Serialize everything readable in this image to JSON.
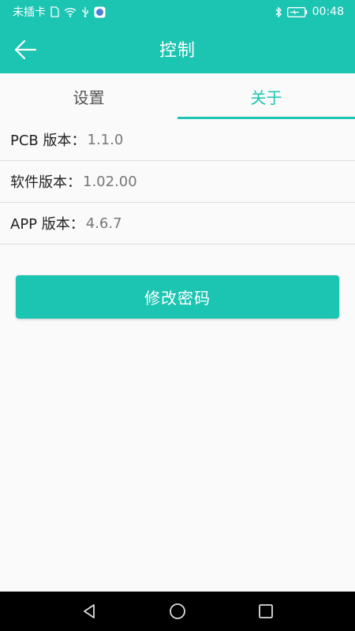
{
  "status_bar": {
    "carrier": "未插卡",
    "time": "00:48",
    "icons": [
      "sim-icon",
      "wifi-icon",
      "usb-icon",
      "app-notification-icon",
      "bluetooth-icon",
      "battery-charging-icon"
    ]
  },
  "app_bar": {
    "title": "控制",
    "back_icon": "arrow-left-icon"
  },
  "tabs": [
    {
      "label": "设置",
      "active": false
    },
    {
      "label": "关于",
      "active": true
    }
  ],
  "about": {
    "rows": [
      {
        "label": "PCB 版本：",
        "value": "1.1.0"
      },
      {
        "label": "软件版本：",
        "value": "1.02.00"
      },
      {
        "label": "APP 版本：",
        "value": "4.6.7"
      }
    ]
  },
  "actions": {
    "change_password": "修改密码"
  },
  "colors": {
    "accent": "#1cc4b2",
    "background": "#fafafa",
    "nav_bar": "#000000"
  },
  "nav_bar": {
    "icons": [
      "back-triangle-icon",
      "home-circle-icon",
      "recents-square-icon"
    ]
  }
}
